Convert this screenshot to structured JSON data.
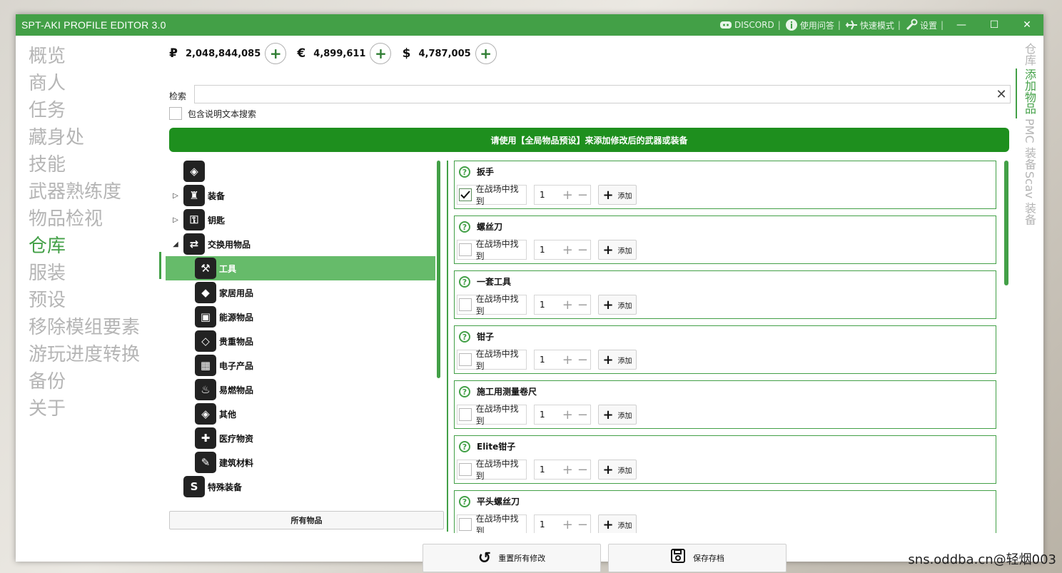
{
  "window": {
    "title": "SPT-AKI PROFILE EDITOR  3.0",
    "links": [
      {
        "icon": "discord-icon",
        "label": "DISCORD"
      },
      {
        "icon": "info-icon",
        "label": "使用问答"
      },
      {
        "icon": "plane-icon",
        "label": "快速模式"
      },
      {
        "icon": "wrench-icon",
        "label": "设置"
      }
    ],
    "controls": {
      "minimize": "—",
      "maximize": "☐",
      "close": "✕"
    }
  },
  "sidebar": {
    "items": [
      {
        "label": "概览",
        "active": false
      },
      {
        "label": "商人",
        "active": false
      },
      {
        "label": "任务",
        "active": false
      },
      {
        "label": "藏身处",
        "active": false
      },
      {
        "label": "技能",
        "active": false
      },
      {
        "label": "武器熟练度",
        "active": false
      },
      {
        "label": "物品检视",
        "active": false
      },
      {
        "label": "仓库",
        "active": true
      },
      {
        "label": "服装",
        "active": false
      },
      {
        "label": "预设",
        "active": false
      },
      {
        "label": "移除模组要素",
        "active": false
      },
      {
        "label": "游玩进度转换",
        "active": false
      },
      {
        "label": "备份",
        "active": false
      },
      {
        "label": "关于",
        "active": false
      }
    ]
  },
  "currency": [
    {
      "symbol": "₽",
      "value": "2,048,844,085"
    },
    {
      "symbol": "€",
      "value": "4,899,611"
    },
    {
      "symbol": "$",
      "value": "4,787,005"
    }
  ],
  "search": {
    "label": "检索",
    "value": "",
    "placeholder": "",
    "include_desc_label": "包含说明文本搜索",
    "include_desc_checked": false
  },
  "banner": "请使用【全局物品预设】来添加修改后的武器或装备",
  "tree": {
    "nodes": [
      {
        "label": "",
        "icon": "layers-icon",
        "glyph": "◈",
        "level": 0,
        "expander": "",
        "selected": false
      },
      {
        "label": "装备",
        "icon": "gear-bag-icon",
        "glyph": "♜",
        "level": 0,
        "expander": "▷",
        "selected": false
      },
      {
        "label": "钥匙",
        "icon": "key-icon",
        "glyph": "⚿",
        "level": 0,
        "expander": "▷",
        "selected": false
      },
      {
        "label": "交换用物品",
        "icon": "exchange-icon",
        "glyph": "⇄",
        "level": 0,
        "expander": "◢",
        "selected": false
      },
      {
        "label": "工具",
        "icon": "tools-icon",
        "glyph": "⚒",
        "level": 1,
        "expander": "",
        "selected": true
      },
      {
        "label": "家居用品",
        "icon": "tag-icon",
        "glyph": "◆",
        "level": 1,
        "expander": "",
        "selected": false
      },
      {
        "label": "能源物品",
        "icon": "battery-icon",
        "glyph": "▣",
        "level": 1,
        "expander": "",
        "selected": false
      },
      {
        "label": "贵重物品",
        "icon": "diamond-icon",
        "glyph": "◇",
        "level": 1,
        "expander": "",
        "selected": false
      },
      {
        "label": "电子产品",
        "icon": "chip-icon",
        "glyph": "▦",
        "level": 1,
        "expander": "",
        "selected": false
      },
      {
        "label": "易燃物品",
        "icon": "flame-icon",
        "glyph": "♨",
        "level": 1,
        "expander": "",
        "selected": false
      },
      {
        "label": "其他",
        "icon": "layers-icon",
        "glyph": "◈",
        "level": 1,
        "expander": "",
        "selected": false
      },
      {
        "label": "医疗物资",
        "icon": "medical-icon",
        "glyph": "✚",
        "level": 1,
        "expander": "",
        "selected": false
      },
      {
        "label": "建筑材料",
        "icon": "pen-icon",
        "glyph": "✎",
        "level": 1,
        "expander": "",
        "selected": false
      },
      {
        "label": "特殊装备",
        "icon": "special-s-icon",
        "glyph": "S",
        "level": 0,
        "expander": "",
        "selected": false
      }
    ],
    "all_items_label": "所有物品"
  },
  "items": [
    {
      "name": "扳手",
      "found_label": "在战场中找到",
      "found": true,
      "qty": "1",
      "add_label": "添加"
    },
    {
      "name": "螺丝刀",
      "found_label": "在战场中找到",
      "found": false,
      "qty": "1",
      "add_label": "添加"
    },
    {
      "name": "一套工具",
      "found_label": "在战场中找到",
      "found": false,
      "qty": "1",
      "add_label": "添加"
    },
    {
      "name": "钳子",
      "found_label": "在战场中找到",
      "found": false,
      "qty": "1",
      "add_label": "添加"
    },
    {
      "name": "施工用测量卷尺",
      "found_label": "在战场中找到",
      "found": false,
      "qty": "1",
      "add_label": "添加"
    },
    {
      "name": "Elite钳子",
      "found_label": "在战场中找到",
      "found": false,
      "qty": "1",
      "add_label": "添加"
    },
    {
      "name": "平头螺丝刀",
      "found_label": "在战场中找到",
      "found": false,
      "qty": "1",
      "add_label": "添加"
    }
  ],
  "bottom": {
    "reset_label": "重置所有修改",
    "save_label": "保存存档"
  },
  "right_tabs": [
    {
      "label": "仓库",
      "active": false
    },
    {
      "label": "添加物品",
      "active": true
    },
    {
      "label": "PMC 装备",
      "active": false
    },
    {
      "label": "Scav 装备",
      "active": false
    }
  ],
  "watermark": "sns.oddba.cn@轻烟003",
  "colors": {
    "accent": "#43a047",
    "banner": "#1e8f1e",
    "selected": "#66bb6a"
  }
}
